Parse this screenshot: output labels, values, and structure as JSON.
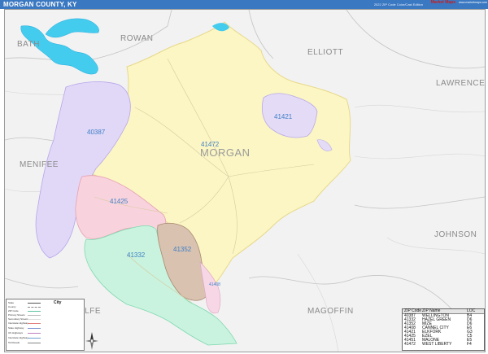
{
  "header": {
    "title": "MORGAN COUNTY, KY",
    "edition": "2022 ZIP Code Color/Cast Edition",
    "logo_text": "Market Maps",
    "logo_sub": "www.marketmaps.com"
  },
  "map": {
    "neighbor_counties": [
      "BATH",
      "ROWAN",
      "ELLIOTT",
      "LAWRENCE",
      "MENIFEE",
      "JOHNSON",
      "MAGOFFIN",
      "WOLFE"
    ],
    "county_name": "MORGAN",
    "zip_labels": [
      "41472",
      "41421",
      "40387",
      "41425",
      "41352",
      "41332",
      "41408"
    ],
    "colors": {
      "41472": "#fbf6c4",
      "41421": "#e4dbf6",
      "40387": "#e1d8f7",
      "41425": "#f8d3dd",
      "41352": "#d9c2b0",
      "41332": "#c9f3de",
      "41408": "#f7d7e6",
      "water": "#44ccee",
      "background": "#f2f2f2"
    }
  },
  "legend": {
    "items": [
      "State",
      "County",
      "ZIP Code",
      "Primary Streets",
      "Secondary Streets",
      "Interstate Highway",
      "State Highway",
      "US Highways",
      "Interstate Highway",
      "Toll Roads"
    ],
    "city_symbol": "City"
  },
  "zip_table": {
    "headers": [
      "ZIP Code",
      "ZIP Name",
      "LOC"
    ],
    "rows": [
      [
        "40387",
        "WELLINGTON",
        "B4"
      ],
      [
        "41332",
        "HAZEL GREEN",
        "D6"
      ],
      [
        "41352",
        "MIZE",
        "D6"
      ],
      [
        "41408",
        "CANNEL CITY",
        "E6"
      ],
      [
        "41421",
        "ELKFORK",
        "G3"
      ],
      [
        "41425",
        "EZEL",
        "C5"
      ],
      [
        "41451",
        "MALONE",
        "E5"
      ],
      [
        "41472",
        "WEST LIBERTY",
        "F4"
      ]
    ]
  }
}
